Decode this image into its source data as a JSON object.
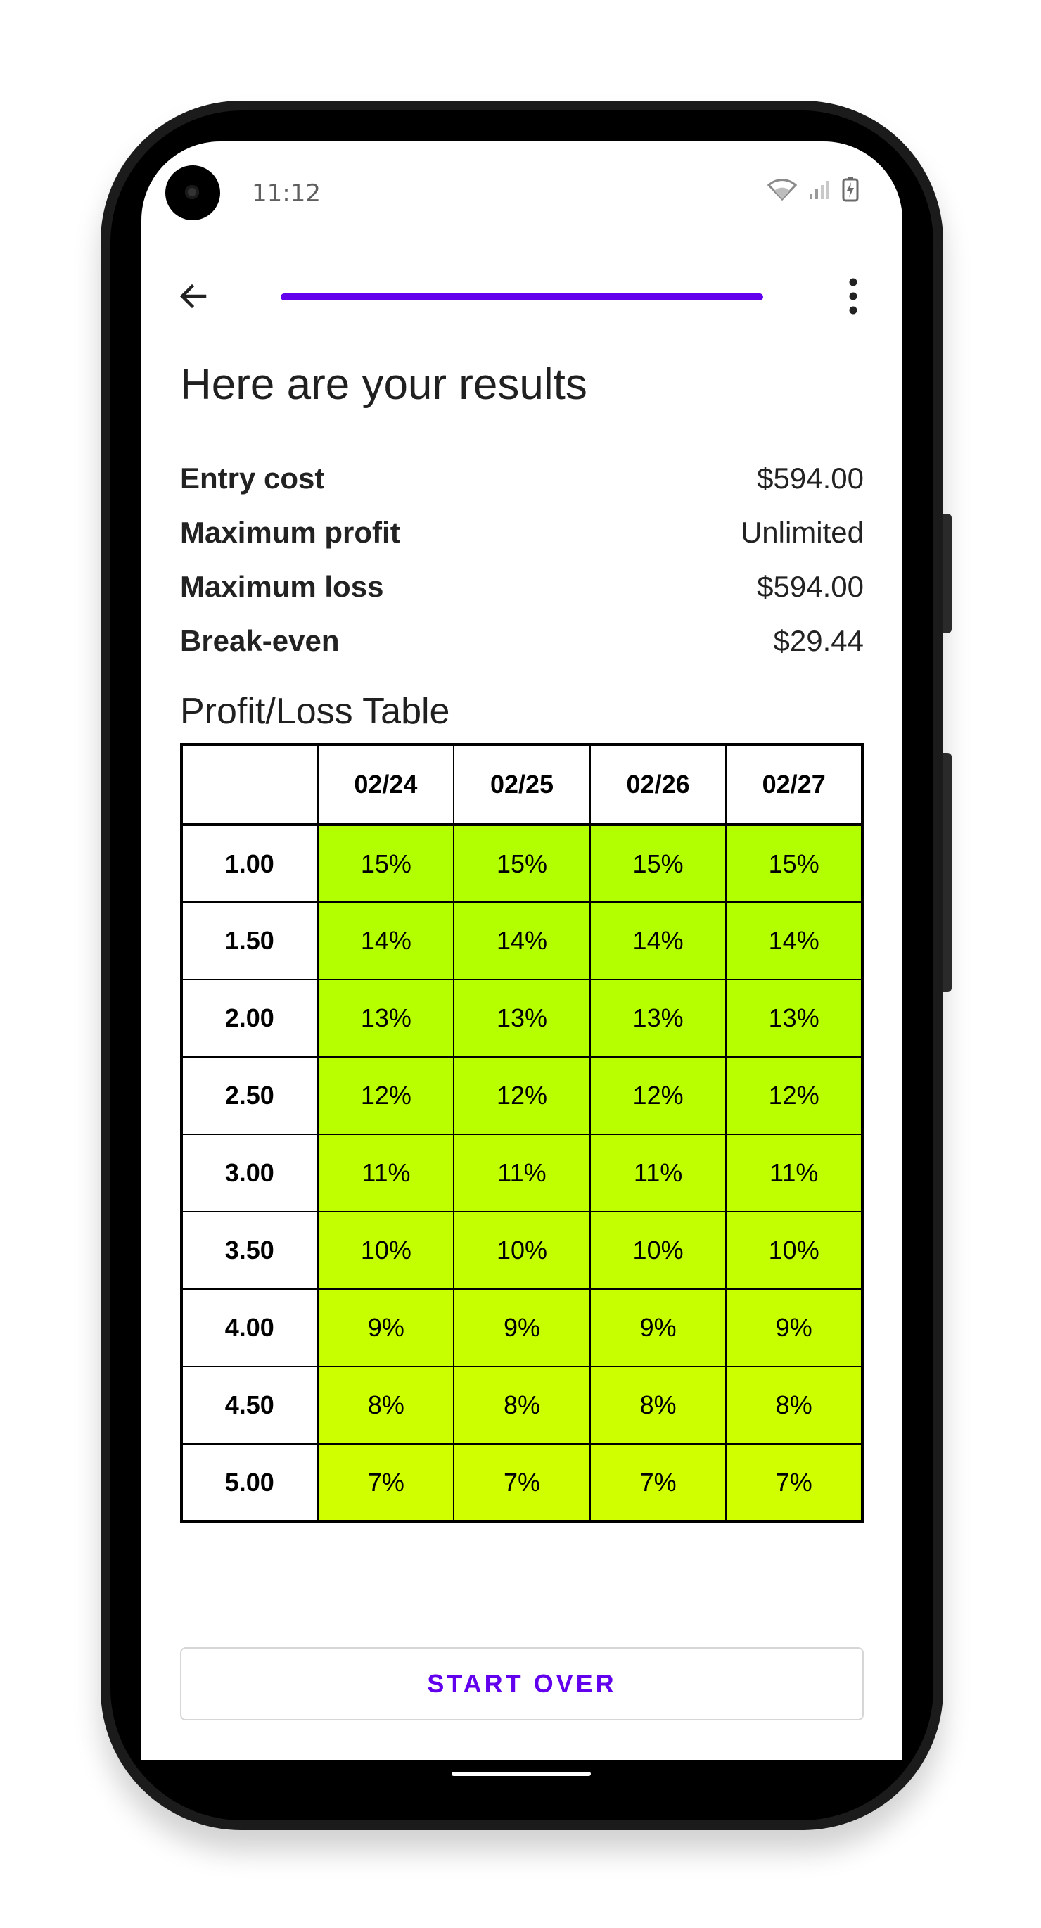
{
  "status": {
    "time": "11:12",
    "icons": [
      "wifi-icon",
      "cell-signal-icon",
      "battery-charging-icon"
    ]
  },
  "appbar": {
    "back_icon": "arrow-back-icon",
    "more_icon": "more-vertical-icon",
    "progress_fraction": 1.0,
    "accent": "#6200ee"
  },
  "title": "Here are your results",
  "summary": [
    {
      "label": "Entry cost",
      "value": "$594.00"
    },
    {
      "label": "Maximum profit",
      "value": "Unlimited"
    },
    {
      "label": "Maximum loss",
      "value": "$594.00"
    },
    {
      "label": "Break-even",
      "value": "$29.44"
    }
  ],
  "table": {
    "title": "Profit/Loss Table",
    "corner": "",
    "columns": [
      "02/24",
      "02/25",
      "02/26",
      "02/27"
    ],
    "rows": [
      {
        "price": "1.00",
        "cells": [
          "15%",
          "15%",
          "15%",
          "15%"
        ],
        "color": "#b1ff00"
      },
      {
        "price": "1.50",
        "cells": [
          "14%",
          "14%",
          "14%",
          "14%"
        ],
        "color": "#b3ff00"
      },
      {
        "price": "2.00",
        "cells": [
          "13%",
          "13%",
          "13%",
          "13%"
        ],
        "color": "#b6ff00"
      },
      {
        "price": "2.50",
        "cells": [
          "12%",
          "12%",
          "12%",
          "12%"
        ],
        "color": "#baff00"
      },
      {
        "price": "3.00",
        "cells": [
          "11%",
          "11%",
          "11%",
          "11%"
        ],
        "color": "#bfff00"
      },
      {
        "price": "3.50",
        "cells": [
          "10%",
          "10%",
          "10%",
          "10%"
        ],
        "color": "#c3ff00"
      },
      {
        "price": "4.00",
        "cells": [
          "9%",
          "9%",
          "9%",
          "9%"
        ],
        "color": "#c8ff00"
      },
      {
        "price": "4.50",
        "cells": [
          "8%",
          "8%",
          "8%",
          "8%"
        ],
        "color": "#ccff00"
      },
      {
        "price": "5.00",
        "cells": [
          "7%",
          "7%",
          "7%",
          "7%"
        ],
        "color": "#d0ff00"
      }
    ]
  },
  "start_over_label": "START OVER"
}
